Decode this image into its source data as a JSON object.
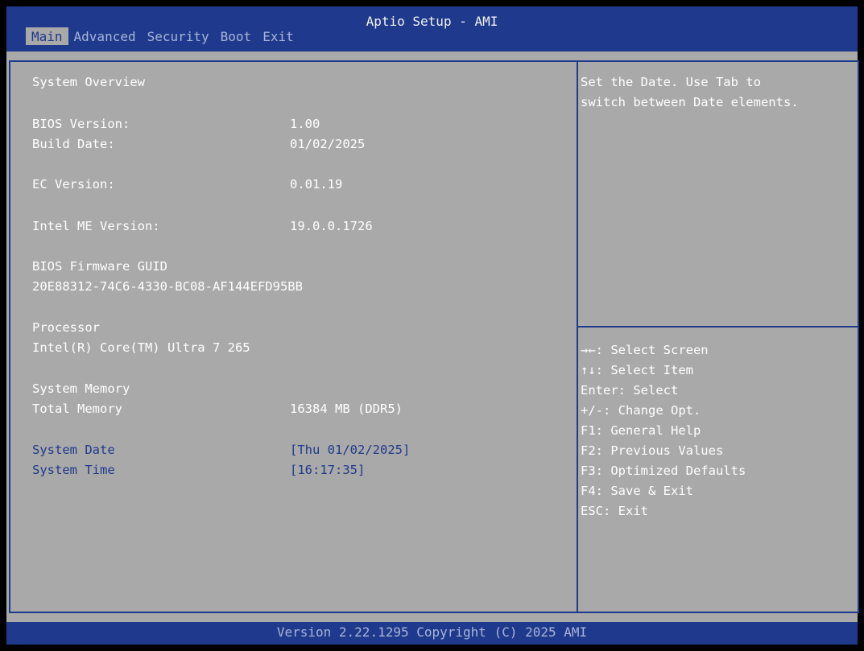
{
  "header": {
    "title": "Aptio Setup - AMI",
    "tabs": [
      {
        "label": "Main",
        "active": true
      },
      {
        "label": "Advanced"
      },
      {
        "label": "Security"
      },
      {
        "label": "Boot"
      },
      {
        "label": "Exit"
      }
    ]
  },
  "main": {
    "system_overview": "System Overview",
    "bios_version_label": "BIOS Version:",
    "bios_version_value": "1.00",
    "build_date_label": "Build Date:",
    "build_date_value": "01/02/2025",
    "ec_version_label": "EC Version:",
    "ec_version_value": "0.01.19",
    "me_version_label": "Intel ME Version:",
    "me_version_value": "19.0.0.1726",
    "guid_label": "BIOS Firmware GUID",
    "guid_value": "20E88312-74C6-4330-BC08-AF144EFD95BB",
    "processor_label": "Processor",
    "processor_value": "Intel(R) Core(TM) Ultra 7 265",
    "memory_label": "System Memory",
    "total_memory_label": "Total Memory",
    "total_memory_value": "16384 MB (DDR5)",
    "system_date_label": "System Date",
    "system_date_value": "[Thu 01/02/2025]",
    "system_time_label": "System Time",
    "system_time_value": "[16:17:35]"
  },
  "help": {
    "line1": "Set the Date. Use Tab to",
    "line2": "switch between Date elements."
  },
  "keys": [
    "→←: Select Screen",
    "↑↓: Select Item",
    "Enter: Select",
    "+/-: Change Opt.",
    "F1: General Help",
    "F2: Previous Values",
    "F3: Optimized Defaults",
    "F4: Save & Exit",
    "ESC: Exit"
  ],
  "footer": {
    "text": "Version 2.22.1295 Copyright (C) 2025 AMI"
  },
  "colors": {
    "header_bg": "#1f3a8c",
    "panel_bg": "#a9a9a9",
    "highlight_text": "#1f3a8c",
    "text": "#ffffff"
  }
}
